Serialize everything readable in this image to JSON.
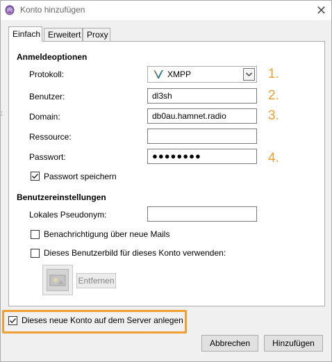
{
  "window": {
    "title": "Konto hinzufügen",
    "close_glyph": "✕"
  },
  "tabs": [
    {
      "label": "Einfach",
      "active": true
    },
    {
      "label": "Erweitert",
      "active": false
    },
    {
      "label": "Proxy",
      "active": false
    }
  ],
  "login_options": {
    "heading": "Anmeldeoptionen",
    "protocol": {
      "label": "Protokoll:",
      "value": "XMPP",
      "icon": "xmpp-icon"
    },
    "user": {
      "label": "Benutzer:",
      "value": "dl3sh"
    },
    "domain": {
      "label": "Domain:",
      "value": "db0au.hamnet.radio"
    },
    "resource": {
      "label": "Ressource:",
      "value": ""
    },
    "password": {
      "label": "Passwort:",
      "value": "●●●●●●●●"
    },
    "save_password": {
      "label": "Passwort speichern",
      "checked": true
    }
  },
  "user_settings": {
    "heading": "Benutzereinstellungen",
    "local_alias": {
      "label": "Lokales Pseudonym:",
      "value": ""
    },
    "new_mail_notify": {
      "label": "Benachrichtigung über neue Mails",
      "checked": false
    },
    "use_buddy_icon": {
      "label": "Dieses Benutzerbild für dieses Konto verwenden:",
      "checked": false
    },
    "remove_label": "Entfernen"
  },
  "annotations": {
    "n1": "1.",
    "n2": "2.",
    "n3": "3.",
    "n4": "4."
  },
  "create_account": {
    "label": "Dieses neue Konto auf dem Server anlegen",
    "checked": true
  },
  "buttons": {
    "cancel": "Abbrechen",
    "add": "Hinzufügen"
  },
  "colors": {
    "accent_orange": "#f0a030",
    "dialog_bg": "#f0f0f0"
  }
}
